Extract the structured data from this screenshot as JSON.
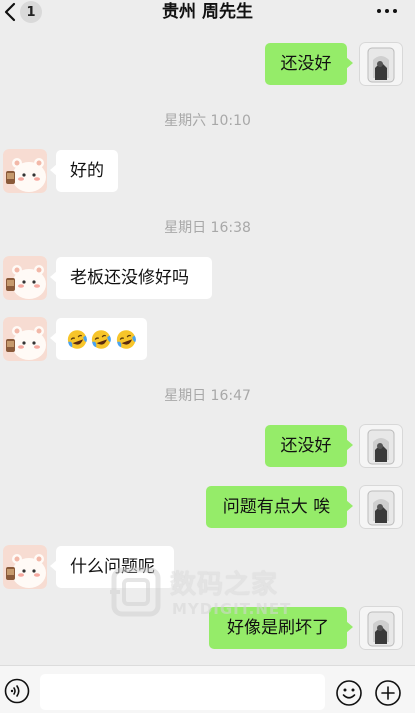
{
  "header": {
    "back_badge": "1",
    "title": "贵州 周先生"
  },
  "messages": [
    {
      "side": "right",
      "text": "还没好"
    },
    {
      "timestamp": "星期六 10:10"
    },
    {
      "side": "left",
      "text": "好的"
    },
    {
      "timestamp": "星期日 16:38"
    },
    {
      "side": "left",
      "text": "老板还没修好吗"
    },
    {
      "side": "left",
      "emoji": [
        "face-with-tears-of-joy",
        "face-with-tears-of-joy",
        "face-with-tears-of-joy"
      ]
    },
    {
      "timestamp": "星期日 16:47"
    },
    {
      "side": "right",
      "text": "还没好"
    },
    {
      "side": "right",
      "text": "问题有点大 唉"
    },
    {
      "side": "left",
      "text": "什么问题呢"
    },
    {
      "side": "right",
      "text": "好像是刷坏了"
    }
  ],
  "watermark": {
    "title": "数码之家",
    "subtitle": "MYDIGIT.NET"
  },
  "input_bar": {
    "text_value": ""
  },
  "icons": {
    "back": "chevron-left-icon",
    "more": "more-dots-icon",
    "voice": "voice-icon",
    "emoji": "emoji-icon",
    "plus": "plus-icon"
  },
  "colors": {
    "background": "#ededed",
    "bubble_sent": "#95ec69",
    "bubble_received": "#ffffff",
    "timestamp_text": "#a8a8a8"
  }
}
